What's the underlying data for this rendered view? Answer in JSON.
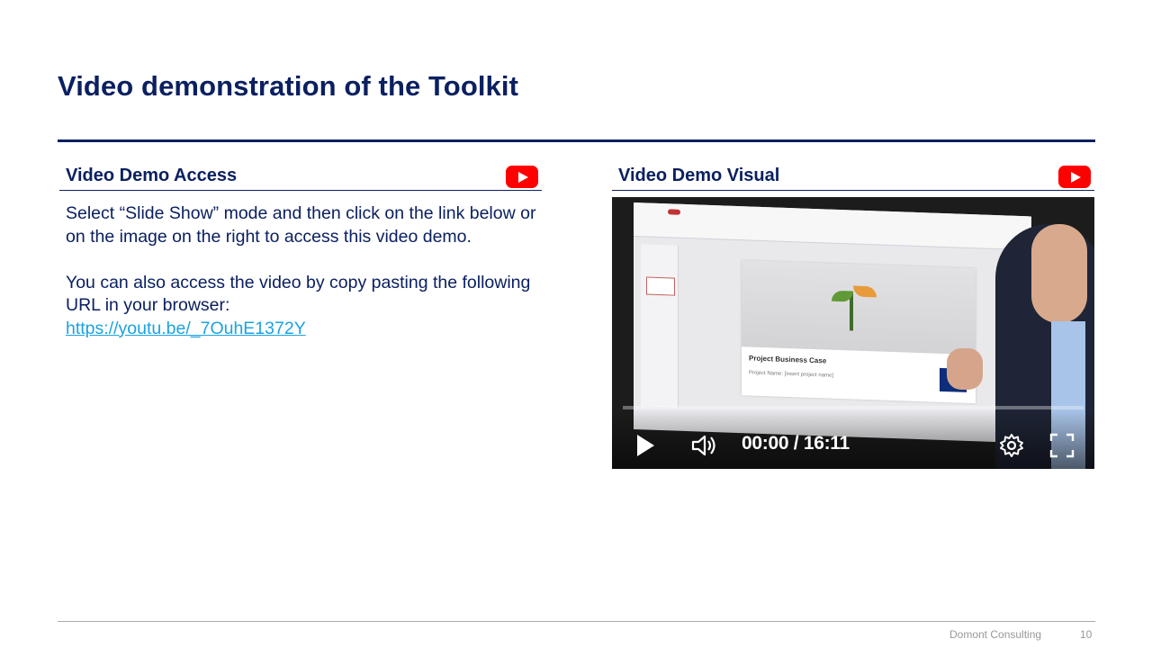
{
  "slide": {
    "title": "Video demonstration of the Toolkit"
  },
  "left": {
    "heading": "Video Demo Access",
    "icon": "youtube-icon",
    "paragraph1": "Select “Slide Show” mode and then click on the link below or on the image on the right to access this video demo.",
    "paragraph2": "You can also access the video by copy pasting the following URL in your browser:",
    "link": "https://youtu.be/_7OuhE1372Y"
  },
  "right": {
    "heading": "Video Demo Visual",
    "icon": "youtube-icon",
    "video": {
      "time": "00:00 / 16:11",
      "slide_title": "Project Business Case",
      "slide_subtitle": "Project Name: [insert project name]"
    }
  },
  "footer": {
    "company": "Domont Consulting",
    "page": "10"
  },
  "colors": {
    "navy": "#0b2060",
    "link": "#1aa3e0",
    "youtube_red": "#ff0000"
  }
}
